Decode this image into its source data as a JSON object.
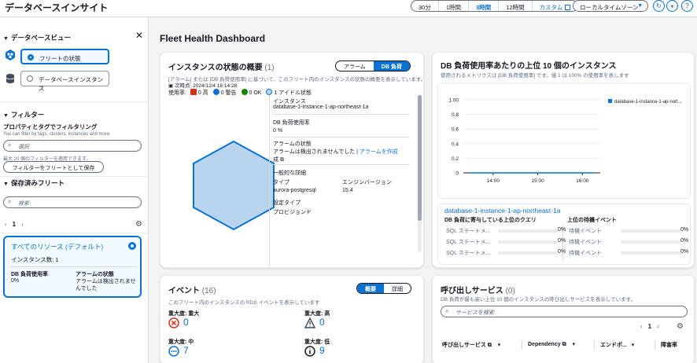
{
  "app_title": "データベースインサイト",
  "time_range": {
    "options": [
      "30分",
      "1時間",
      "3時間",
      "12時間",
      "カスタム"
    ],
    "selected": "3時間"
  },
  "timezone": {
    "value": "ローカルタイムゾーン"
  },
  "sidebar": {
    "db_view_heading": "データベースビュー",
    "view_options": [
      {
        "label": "フリートの状態",
        "selected": true
      },
      {
        "label": "データベースインスタンス",
        "selected": false
      }
    ],
    "filter_heading": "フィルター",
    "filter_label": "プロパティとタグでフィルタリング",
    "filter_hint": "You can filter by tags, clusters, instances and more.",
    "filter_placeholder": "選択",
    "filter_limit": "最大 20 個のフィルターを適用できます。",
    "save_filter_button": "フィルターをフリートとして保存",
    "saved_heading": "保存済みフリート",
    "search_placeholder": "検索",
    "page": "1",
    "fleet_card": {
      "title": "すべてのリソース (デフォルト)",
      "instance_count": "インスタンス数: 1",
      "load_label": "DB 負荷使用率",
      "load_value": "0%",
      "alarm_label": "アラームの状態",
      "alarm_value": "アラームは検出されませんでした"
    }
  },
  "main_title": "Fleet Health Dashboard",
  "overview": {
    "title": "インスタンスの状態の概要",
    "count": "(1)",
    "toggle": [
      "アラーム",
      "DB 負荷"
    ],
    "toggle_selected": "DB 負荷",
    "desc": "[アラーム] または [DB 負荷使用率] に基づいて、このフリート内のインスタンスの状態の概要を表示しています。",
    "next_time": "次時点: 2024/12/4 16:14:28",
    "usage_label": "使用率:",
    "legend": [
      {
        "label": "0 高",
        "color": "#d13212"
      },
      {
        "label": "0 警告",
        "color": "#0972d3"
      },
      {
        "label": "0 OK",
        "color": "#1d8102"
      },
      {
        "label": "1 アイドル状態",
        "color": "#b8d4ef"
      }
    ],
    "detail": {
      "instance_label": "インスタンス",
      "instance_name": "database-1-instance-1-ap-northeast-1a",
      "load_label": "DB 負荷使用率",
      "load_value": "0 %",
      "alarm_label": "アラームの状態",
      "alarm_text": "アラームは検出されませんでした |",
      "alarm_link": "アラームを作成",
      "general_label": "一般的な詳細",
      "type_label": "タイプ",
      "type_value": "aurora-postgresql",
      "engine_label": "エンジンバージョン",
      "engine_value": "15.4",
      "config_label": "設定タイプ",
      "config_value": "プロビジョンド"
    }
  },
  "top10": {
    "title": "DB 負荷使用率あたりの上位 10 個のインスタンス",
    "desc": "使用されるメトリクスは [DB 負荷使用率] です。値 1 は 100% の使用率を表します",
    "instance_link": "database-1-instance-1-ap-northeast-1a",
    "top_query_label": "DB 負荷に寄与している上位のクエリ",
    "top_wait_label": "上位の待機イベント",
    "query_rows": [
      {
        "label": "SQL ステートメ...",
        "value": "0%"
      },
      {
        "label": "SQL ステートメ...",
        "value": "0%"
      },
      {
        "label": "SQL ステートメ...",
        "value": "0%"
      }
    ],
    "wait_rows": [
      {
        "label": "待機イベント",
        "value": "0%"
      },
      {
        "label": "待機イベント",
        "value": "0%"
      },
      {
        "label": "待機イベント",
        "value": "0%"
      }
    ]
  },
  "chart_data": {
    "type": "line",
    "x": [
      "13:30",
      "13:45",
      "14:00",
      "14:15",
      "14:30",
      "14:45",
      "15:00",
      "15:15",
      "15:30",
      "15:45",
      "16:00",
      "16:14"
    ],
    "series": [
      {
        "name": "database-1-instance-1-ap-nort...",
        "values": [
          0,
          0,
          0,
          0,
          0,
          0,
          0,
          0,
          0,
          0,
          0,
          0
        ],
        "color": "#0972d3"
      }
    ],
    "y_ticks": [
      "1.00",
      "0.8",
      "0.6",
      "0.4",
      "0.2",
      "0"
    ],
    "x_ticks": [
      "14:00",
      "15:00",
      "16:00"
    ],
    "ylim": [
      0,
      1
    ],
    "legend_position": "top-right",
    "grid": true
  },
  "events": {
    "title": "イベント",
    "count": "(16)",
    "toggle": [
      "概要",
      "詳細"
    ],
    "toggle_selected": "概要",
    "desc": "このフリート内のインスタンスの RDS イベントを表示しています",
    "items": [
      {
        "label": "重大度: 重大",
        "count": "0"
      },
      {
        "label": "重大度: 高",
        "count": "0"
      },
      {
        "label": "重大度: 中",
        "count": "7"
      },
      {
        "label": "重大度: 低",
        "count": "9"
      }
    ]
  },
  "services": {
    "title": "呼び出しサービス",
    "count": "(0)",
    "desc": "DB 負荷が最も高い上位 10 個のインスタンスの呼び出しサービスを表示しています。",
    "search_placeholder": "サービスを検索",
    "page": "1",
    "columns": [
      "呼び出しサービス",
      "Dependency",
      "エンドポ...",
      "障害率"
    ]
  }
}
